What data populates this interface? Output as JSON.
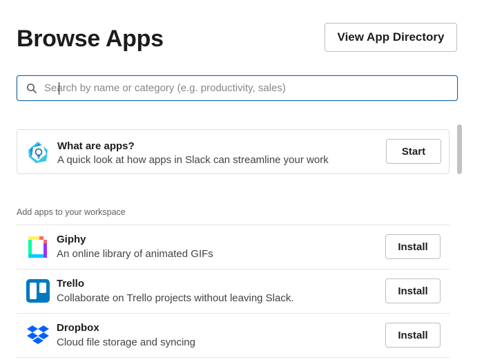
{
  "header": {
    "title": "Browse Apps",
    "directory_button": "View App Directory"
  },
  "search": {
    "placeholder": "Search by name or category (e.g. productivity, sales)",
    "value": ""
  },
  "intro": {
    "icon": "lightbulb-icon",
    "title": "What are apps?",
    "description": "A quick look at how apps in Slack can streamline your work",
    "button": "Start"
  },
  "section": {
    "label": "Add apps to your workspace"
  },
  "apps": [
    {
      "icon": "giphy-icon",
      "name": "Giphy",
      "description": "An online library of animated GIFs",
      "button": "Install"
    },
    {
      "icon": "trello-icon",
      "name": "Trello",
      "description": "Collaborate on Trello projects without leaving Slack.",
      "button": "Install"
    },
    {
      "icon": "dropbox-icon",
      "name": "Dropbox",
      "description": "Cloud file storage and syncing",
      "button": "Install"
    }
  ],
  "colors": {
    "focus_border": "#1264a3",
    "trello_blue": "#0079bf",
    "dropbox_blue": "#0061fe"
  }
}
